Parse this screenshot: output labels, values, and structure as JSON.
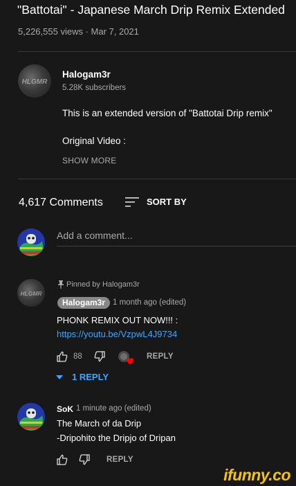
{
  "video": {
    "title": "\"Battotai\" - Japanese March Drip Remix Extended",
    "meta": "5,226,555 views · Mar 7, 2021"
  },
  "channel": {
    "name": "Halogam3r",
    "subscribers": "5.28K subscribers",
    "avatar_text": "HLGMR",
    "description_line1": "This is an extended version of \"Battotai Drip remix\"",
    "description_line2": "Original Video :",
    "show_more": "SHOW MORE"
  },
  "comments_header": {
    "count": "4,617 Comments",
    "sort_label": "SORT BY"
  },
  "add_comment": {
    "placeholder": "Add a comment..."
  },
  "pinned_comment": {
    "pinned_by": "Pinned by Halogam3r",
    "author": "Halogam3r",
    "time": "1 month ago (edited)",
    "text": "PHONK REMIX OUT NOW!!! :",
    "link": "https://youtu.be/VzpwL4J9734",
    "likes": "88",
    "reply_label": "REPLY",
    "replies_toggle": "1 REPLY"
  },
  "second_comment": {
    "author": "SoK",
    "time": "1 minute ago (edited)",
    "line1": "The March of da Drip",
    "line2": "-Dripohito the Dripjo of Dripan",
    "reply_label": "REPLY"
  },
  "watermark": "ifunny.co",
  "colors": {
    "background": "#181818",
    "link": "#3ea6ff",
    "muted": "#aaaaaa",
    "heart": "#ff0000",
    "watermark": "#f5c500"
  }
}
